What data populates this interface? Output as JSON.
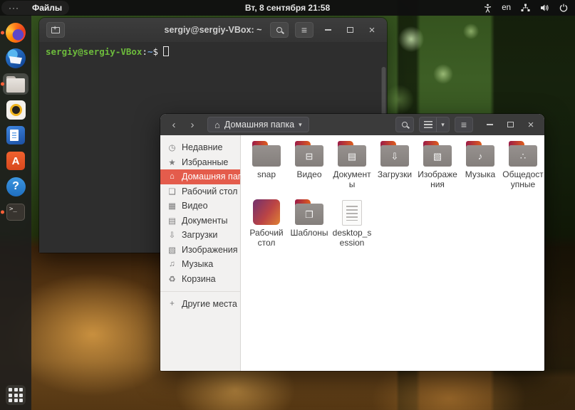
{
  "topbar": {
    "activities_dots": "···",
    "app_name": "Файлы",
    "clock": "Вт, 8 сентября 21:58",
    "keyboard_layout": "en",
    "icons": [
      "accessibility-icon",
      "network-icon",
      "volume-icon",
      "power-icon"
    ]
  },
  "dock": {
    "icons": [
      "firefox",
      "thunderbird",
      "files",
      "rhythmbox",
      "libreoffice-writer",
      "ubuntu-software",
      "help",
      "terminal",
      "show-applications"
    ],
    "running": [
      "firefox",
      "files",
      "terminal"
    ],
    "active": "files",
    "terminal_glyph": ">_",
    "software_letter": "A",
    "help_glyph": "?"
  },
  "terminal": {
    "title": "sergiy@sergiy-VBox: ~",
    "prompt_user_host": "sergiy@sergiy-VBox",
    "prompt_colon": ":",
    "prompt_path": "~",
    "prompt_symbol": "$",
    "menu_glyph": "≡"
  },
  "files": {
    "toolbar": {
      "back_glyph": "‹",
      "forward_glyph": "›",
      "home_glyph": "⌂",
      "location_label": "Домашняя папка",
      "caret": "▾",
      "menu_glyph": "≡"
    },
    "window_controls": {
      "close_glyph": "×"
    },
    "sidebar": {
      "items": [
        {
          "label": "Недавние",
          "glyph": "◷"
        },
        {
          "label": "Избранные",
          "glyph": "★"
        },
        {
          "label": "Домашняя папка",
          "glyph": "⌂",
          "selected": true
        },
        {
          "label": "Рабочий стол",
          "glyph": "❑"
        },
        {
          "label": "Видео",
          "glyph": "▦"
        },
        {
          "label": "Документы",
          "glyph": "▤"
        },
        {
          "label": "Загрузки",
          "glyph": "⇩"
        },
        {
          "label": "Изображения",
          "glyph": "▧"
        },
        {
          "label": "Музыка",
          "glyph": "♫"
        },
        {
          "label": "Корзина",
          "glyph": "♻"
        }
      ],
      "other_places": {
        "label": "Другие места",
        "glyph": "+"
      }
    },
    "grid": {
      "items": [
        {
          "label": "snap",
          "type": "folder",
          "emblem": ""
        },
        {
          "label": "Видео",
          "type": "folder",
          "emblem": "⊟"
        },
        {
          "label": "Документы",
          "type": "folder",
          "emblem": "▤"
        },
        {
          "label": "Загрузки",
          "type": "folder",
          "emblem": "⇩"
        },
        {
          "label": "Изображения",
          "type": "folder",
          "emblem": "▧"
        },
        {
          "label": "Музыка",
          "type": "folder",
          "emblem": "♪"
        },
        {
          "label": "Общедоступные",
          "type": "folder",
          "emblem": "∴"
        },
        {
          "label": "Рабочий стол",
          "type": "desktop-folder",
          "emblem": ""
        },
        {
          "label": "Шаблоны",
          "type": "folder",
          "emblem": "❐"
        },
        {
          "label": "desktop_session",
          "type": "text-file",
          "emblem": ""
        }
      ]
    }
  },
  "colors": {
    "sidebar_selected": "#e45c4c",
    "ubuntu_orange": "#e95420",
    "prompt_green": "#6dbb3c",
    "prompt_blue": "#6f9fd8",
    "folder_tab_gradient": [
      "#9c1b47",
      "#dd5e1e"
    ],
    "folder_body": "#8f8a87"
  }
}
